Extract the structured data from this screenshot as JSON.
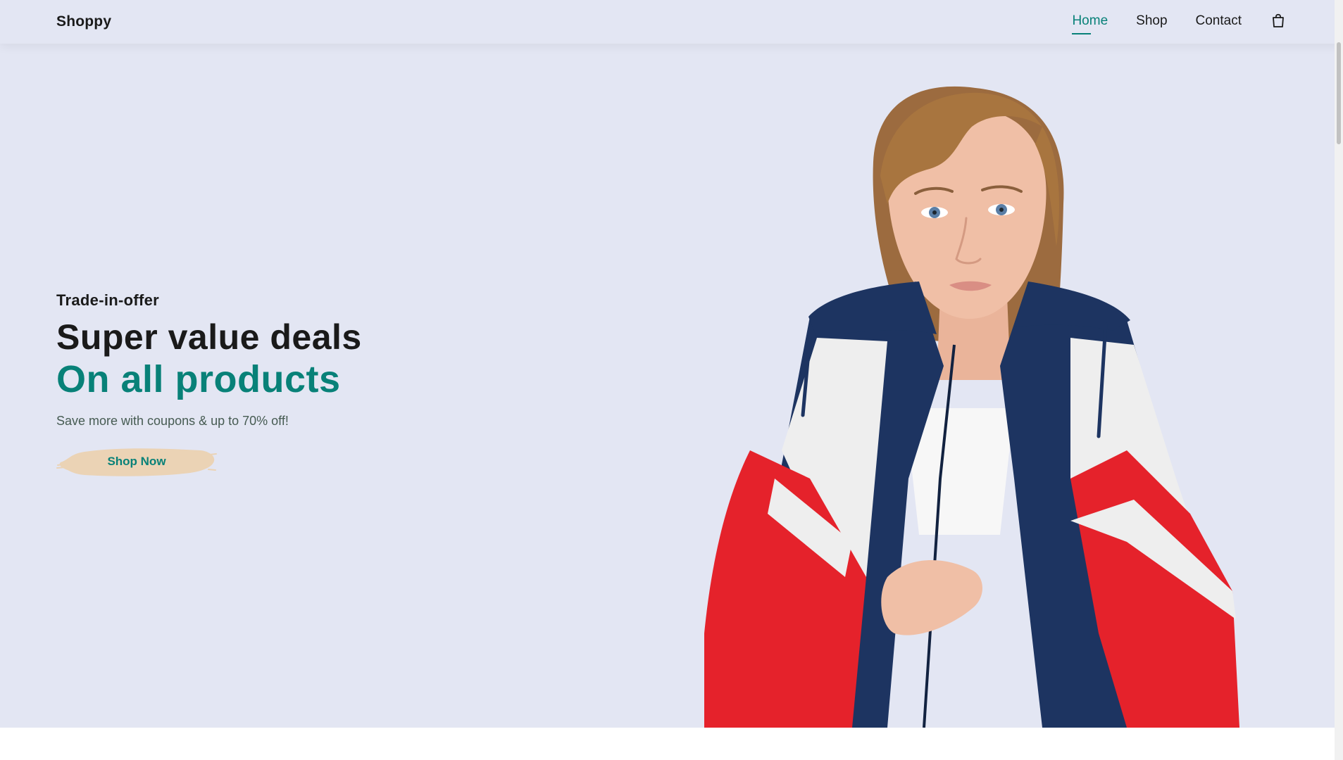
{
  "header": {
    "logo": "Shoppy",
    "nav": [
      {
        "label": "Home",
        "active": true
      },
      {
        "label": "Shop",
        "active": false
      },
      {
        "label": "Contact",
        "active": false
      }
    ],
    "cart_icon": "shopping-bag-icon"
  },
  "hero": {
    "eyebrow": "Trade-in-offer",
    "headline": "Super value deals",
    "headline_accent": "On all products",
    "subtext": "Save more with coupons & up to 70% off!",
    "cta_label": "Shop Now",
    "image": "model-in-windbreaker-jacket"
  },
  "colors": {
    "accent": "#088178",
    "hero_background": "#e3e6f3",
    "button_brush": "#ebd3b5",
    "jacket_navy": "#1d3461",
    "jacket_red": "#e5222b",
    "jacket_white": "#eeeeee"
  }
}
